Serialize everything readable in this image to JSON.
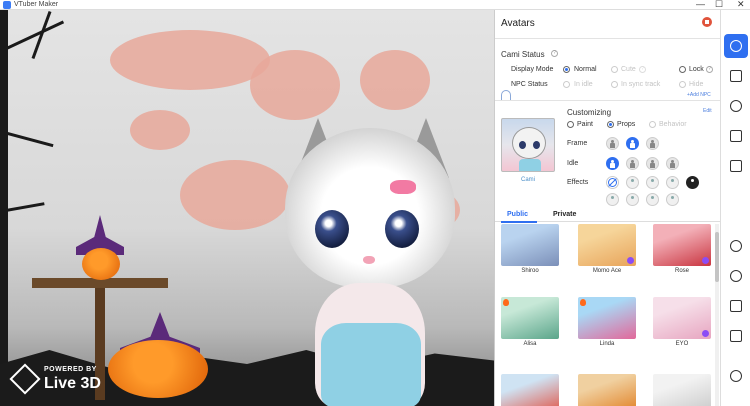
{
  "window": {
    "title": "VTuber Maker",
    "minimize": "—",
    "maximize": "☐",
    "close": "✕"
  },
  "branding": {
    "line1": "POWERED BY",
    "line2": "Live 3D"
  },
  "panel": {
    "title": "Avatars",
    "status_heading": "Cami Status",
    "help_glyph": "?",
    "display_mode_label": "Display Mode",
    "display_mode_options": [
      {
        "label": "Normal",
        "selected": true,
        "enabled": true
      },
      {
        "label": "Cute",
        "selected": false,
        "enabled": false
      },
      {
        "label": "Lock",
        "selected": false,
        "enabled": true
      }
    ],
    "npc_status_label": "NPC Status",
    "npc_status_options": [
      {
        "label": "In idle",
        "enabled": false
      },
      {
        "label": "In sync track",
        "enabled": false
      },
      {
        "label": "Hide",
        "enabled": false
      }
    ],
    "add_npc_link": "+Add NPC",
    "avatar_name": "Cami",
    "customizing_label": "Customizing",
    "edit_link": "Edit",
    "customizing_options": [
      {
        "label": "Paint",
        "selected": false,
        "enabled": true
      },
      {
        "label": "Props",
        "selected": true,
        "enabled": true
      },
      {
        "label": "Behavior",
        "selected": false,
        "enabled": false
      }
    ],
    "frame_label": "Frame",
    "idle_label": "Idle",
    "effects_label": "Effects",
    "tabs": [
      {
        "label": "Public",
        "active": true
      },
      {
        "label": "Private",
        "active": false
      }
    ],
    "avatars": [
      {
        "name": "Shiroo",
        "colors": [
          "#b9d3ef",
          "#7b8fb8"
        ]
      },
      {
        "name": "Momo Ace",
        "colors": [
          "#f6d59a",
          "#e8a45a"
        ]
      },
      {
        "name": "Rose",
        "colors": [
          "#f3b0b8",
          "#c93540"
        ]
      },
      {
        "name": "Alisa",
        "colors": [
          "#c7e8d7",
          "#5aa58a"
        ]
      },
      {
        "name": "Linda",
        "colors": [
          "#a9d8f5",
          "#e2689a"
        ]
      },
      {
        "name": "EYO",
        "colors": [
          "#f6dfe9",
          "#e7a5c0"
        ]
      },
      {
        "name": "",
        "colors": [
          "#cfe3f3",
          "#e24b3b"
        ]
      },
      {
        "name": "",
        "colors": [
          "#f0d0a0",
          "#e07a1a"
        ]
      },
      {
        "name": "",
        "colors": [
          "#f2f2f2",
          "#c6c6c6"
        ]
      }
    ]
  },
  "rail": {
    "items": [
      {
        "name": "rail-avatar-icon",
        "active": true
      },
      {
        "name": "rail-image-icon",
        "active": false
      },
      {
        "name": "rail-emoji-icon",
        "active": false
      },
      {
        "name": "rail-list-icon",
        "active": false
      },
      {
        "name": "rail-expand-icon",
        "active": false
      },
      {
        "name": "rail-webcam-icon",
        "active": false
      },
      {
        "name": "rail-eye-icon",
        "active": false
      },
      {
        "name": "rail-tv-icon",
        "active": false
      },
      {
        "name": "rail-picture-icon",
        "active": false
      },
      {
        "name": "rail-settings-icon",
        "active": false
      }
    ]
  },
  "colors": {
    "accent": "#2f6ff0",
    "close": "#e0533b"
  }
}
